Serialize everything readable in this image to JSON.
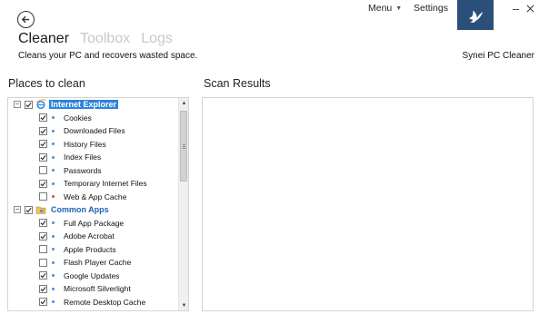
{
  "header": {
    "tabs": [
      {
        "label": "Cleaner",
        "active": true
      },
      {
        "label": "Toolbox",
        "active": false
      },
      {
        "label": "Logs",
        "active": false
      }
    ],
    "tagline": "Cleans your PC and recovers wasted space.",
    "brand": "Synei PC Cleaner",
    "menu_label": "Menu",
    "settings_label": "Settings"
  },
  "places": {
    "title": "Places to clean",
    "groups": [
      {
        "label": "Internet Explorer",
        "icon": "internet-explorer-icon",
        "checked": true,
        "selected": true,
        "items": [
          {
            "label": "Cookies",
            "checked": true
          },
          {
            "label": "Downloaded Files",
            "checked": true
          },
          {
            "label": "History Files",
            "checked": true
          },
          {
            "label": "Index Files",
            "checked": true
          },
          {
            "label": "Passwords",
            "checked": false
          },
          {
            "label": "Temporary Internet Files",
            "checked": true
          },
          {
            "label": "Web & App Cache",
            "checked": false
          }
        ]
      },
      {
        "label": "Common Apps",
        "icon": "apps-folder-icon",
        "checked": true,
        "selected": false,
        "items": [
          {
            "label": "Full App Package",
            "checked": true
          },
          {
            "label": "Adobe Acrobat",
            "checked": true
          },
          {
            "label": "Apple Products",
            "checked": false
          },
          {
            "label": "Flash Player Cache",
            "checked": false
          },
          {
            "label": "Google Updates",
            "checked": true
          },
          {
            "label": "Microsoft Silverlight",
            "checked": true
          },
          {
            "label": "Remote Desktop Cache",
            "checked": true
          }
        ]
      }
    ]
  },
  "results": {
    "title": "Scan Results"
  },
  "colors": {
    "accent": "#2d84d8",
    "group_text": "#1e64b4",
    "logo_tile": "#2a5079",
    "left_stripe": "#2e4a6b"
  }
}
